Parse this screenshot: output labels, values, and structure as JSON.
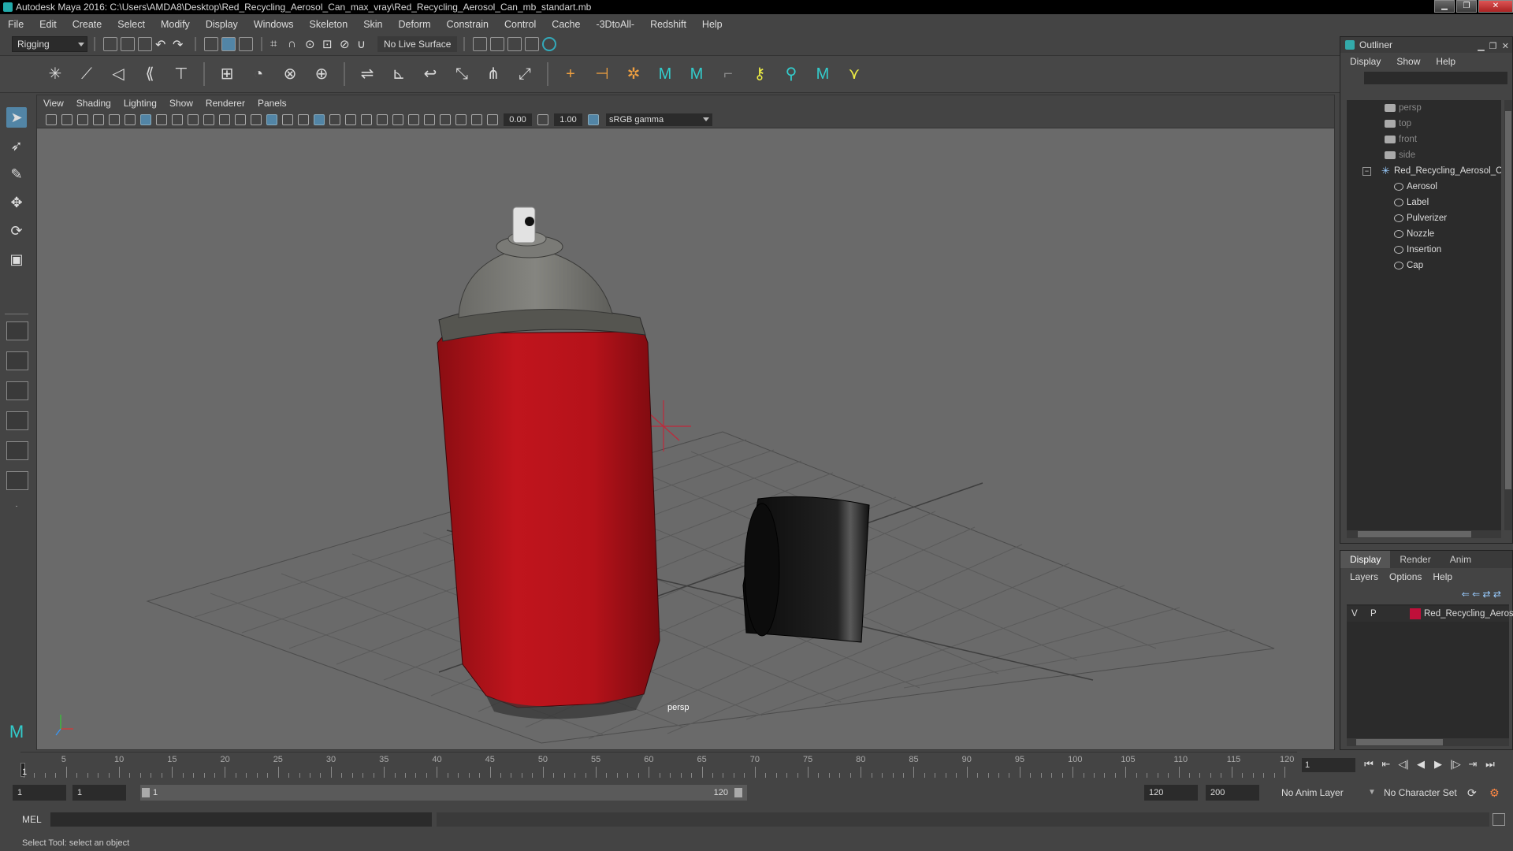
{
  "window": {
    "title": "Autodesk Maya 2016: C:\\Users\\AMDA8\\Desktop\\Red_Recycling_Aerosol_Can_max_vray\\Red_Recycling_Aerosol_Can_mb_standart.mb",
    "minimize": "▁",
    "restore": "❐",
    "close": "✕"
  },
  "menubar": [
    "File",
    "Edit",
    "Create",
    "Select",
    "Modify",
    "Display",
    "Windows",
    "Skeleton",
    "Skin",
    "Deform",
    "Constrain",
    "Control",
    "Cache",
    "-3DtoAll-",
    "Redshift",
    "Help"
  ],
  "statusline": {
    "menuset": "Rigging",
    "live_surface": "No Live Surface"
  },
  "viewport": {
    "menu": [
      "View",
      "Shading",
      "Lighting",
      "Show",
      "Renderer",
      "Panels"
    ],
    "exposure": "0.00",
    "gamma": "1.00",
    "color_space": "sRGB gamma",
    "camera_label": "persp"
  },
  "outliner": {
    "title": "Outliner",
    "menu": [
      "Display",
      "Show",
      "Help"
    ],
    "cameras": [
      "persp",
      "top",
      "front",
      "side"
    ],
    "group": "Red_Recycling_Aerosol_Car",
    "children": [
      "Aerosol",
      "Label",
      "Pulverizer",
      "Nozzle",
      "Insertion",
      "Cap"
    ]
  },
  "layer_editor": {
    "tabs": [
      "Display",
      "Render",
      "Anim"
    ],
    "active_tab": "Display",
    "menu": [
      "Layers",
      "Options",
      "Help"
    ],
    "layer": {
      "visible": "V",
      "playback": "P",
      "name": "Red_Recycling_Aeroso",
      "color": "#c0103a"
    }
  },
  "timeline": {
    "ticks": [
      "5",
      "10",
      "15",
      "20",
      "25",
      "30",
      "35",
      "40",
      "45",
      "50",
      "55",
      "60",
      "65",
      "70",
      "75",
      "80",
      "85",
      "90",
      "95",
      "100",
      "105",
      "110",
      "115",
      "120"
    ],
    "playhead_label": "1",
    "current_frame": "1",
    "min": 1,
    "max": 120
  },
  "range": {
    "start": "1",
    "playback_start": "1",
    "bar_start": "1",
    "bar_end": "120",
    "playback_end": "120",
    "end": "200",
    "anim_layer": "No Anim Layer",
    "character_set": "No Character Set"
  },
  "command": {
    "lang": "MEL"
  },
  "help_line": "Select Tool: select an object",
  "colors": {
    "accent": "#5285a6",
    "can_red": "#b0141c",
    "cap_black": "#111111"
  }
}
